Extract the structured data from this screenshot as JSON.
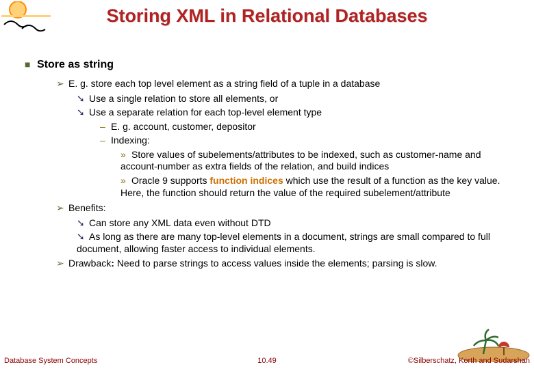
{
  "title": "Storing XML in Relational Databases",
  "heading": "Store as string",
  "p1": "E. g. store each top level element as a string field of a tuple in a database",
  "p1a": "Use a single relation to store all elements, or",
  "p1b": "Use a separate relation for each top-level element type",
  "p1b_i": "E. g.  account, customer, depositor",
  "p1b_ii": "Indexing:",
  "p1b_ii_1": "Store values of subelements/attributes to be indexed, such as customer-name and account-number as extra fields of the relation, and build indices",
  "p1b_ii_2a": "Oracle 9 supports ",
  "p1b_ii_2b": "function indices",
  "p1b_ii_2c": " which use the result of a function as the key value.  Here, the function should return the value of the required subelement/attribute",
  "p2": "Benefits:",
  "p2a": "Can store any XML data even without DTD",
  "p2b": "As long as there are many top-level elements in a document, strings are small compared to full document, allowing faster access to individual elements.",
  "p3a": "Drawback",
  "p3b": ": ",
  "p3c": "Need to parse strings to access values inside the elements;   parsing is slow.",
  "footer_left": "Database System Concepts",
  "footer_center": "10.49",
  "footer_right": "©Silberschatz, Korth and Sudarshan"
}
